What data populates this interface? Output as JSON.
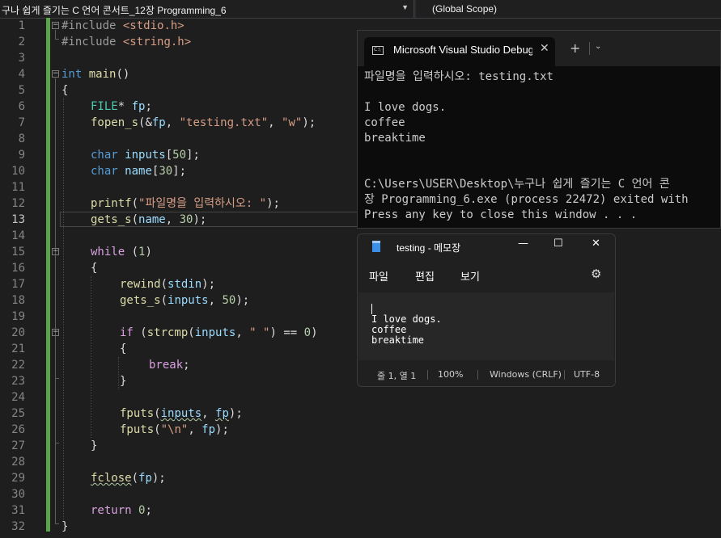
{
  "navbar": {
    "project": "구나 쉽게 즐기는 C 언어 콘서트_12장 Programming_6",
    "scope": "(Global Scope)"
  },
  "editor": {
    "line_numbers": [
      "1",
      "2",
      "3",
      "4",
      "5",
      "6",
      "7",
      "8",
      "9",
      "10",
      "11",
      "12",
      "13",
      "14",
      "15",
      "16",
      "17",
      "18",
      "19",
      "20",
      "21",
      "22",
      "23",
      "24",
      "25",
      "26",
      "27",
      "28",
      "29",
      "30",
      "31",
      "32"
    ],
    "active_line": "13",
    "code": {
      "l1_pp": "#include",
      "l1_hdr": "<stdio.h>",
      "l2_pp": "#include",
      "l2_hdr": "<string.h>",
      "l4_kw": "int",
      "l4_fn": "main",
      "l4_rest": "()",
      "l5": "{",
      "l6_ty": "FILE",
      "l6_star": "* ",
      "l6_var": "fp",
      "l6_semi": ";",
      "l7_fn": "fopen_s",
      "l7_a": "(&",
      "l7_var": "fp",
      "l7_b": ", ",
      "l7_s1": "\"testing.txt\"",
      "l7_c": ", ",
      "l7_s2": "\"w\"",
      "l7_d": ");",
      "l9_kw": "char",
      "l9_var": "inputs",
      "l9_a": "[",
      "l9_num": "50",
      "l9_b": "];",
      "l10_kw": "char",
      "l10_var": "name",
      "l10_a": "[",
      "l10_num": "30",
      "l10_b": "];",
      "l12_fn": "printf",
      "l12_a": "(",
      "l12_str": "\"파일명을 입력하시오: \"",
      "l12_b": ");",
      "l13_fn": "gets_s",
      "l13_a": "(",
      "l13_var": "name",
      "l13_b": ", ",
      "l13_num": "30",
      "l13_c": ");",
      "l15_kw": "while",
      "l15_a": " (",
      "l15_num": "1",
      "l15_b": ")",
      "l16": "{",
      "l17_fn": "rewind",
      "l17_a": "(",
      "l17_var": "stdin",
      "l17_b": ");",
      "l18_fn": "gets_s",
      "l18_a": "(",
      "l18_var": "inputs",
      "l18_b": ", ",
      "l18_num": "50",
      "l18_c": ");",
      "l20_kw": "if",
      "l20_a": " (",
      "l20_fn": "strcmp",
      "l20_b": "(",
      "l20_var": "inputs",
      "l20_c": ", ",
      "l20_str": "\" \"",
      "l20_d": ") == ",
      "l20_num": "0",
      "l20_e": ")",
      "l21": "{",
      "l22_kw": "break",
      "l22_a": ";",
      "l23": "}",
      "l25_fn": "fputs",
      "l25_a": "(",
      "l25_var": "inputs",
      "l25_b": ", ",
      "l25_var2": "fp",
      "l25_c": ");",
      "l26_fn": "fputs",
      "l26_a": "(",
      "l26_str": "\"\\n\"",
      "l26_b": ", ",
      "l26_var": "fp",
      "l26_c": ");",
      "l27": "}",
      "l29_fn": "fclose",
      "l29_a": "(",
      "l29_var": "fp",
      "l29_b": ");",
      "l31_kw": "return",
      "l31_num": "0",
      "l31_a": ";",
      "l32": "}"
    },
    "fold_glyph": "−"
  },
  "console": {
    "tab_icon_label": "C:\\",
    "tab_title": "Microsoft Visual Studio Debug",
    "close_glyph": "✕",
    "plus_glyph": "+",
    "dropdown_glyph": "⌄",
    "lines": [
      "파일명을 입력하시오: testing.txt",
      "",
      "I love dogs.",
      "coffee",
      "breaktime",
      "",
      "",
      "C:\\Users\\USER\\Desktop\\누구나 쉽게 즐기는 C 언어 콘",
      "장 Programming_6.exe (process 22472) exited with",
      "Press any key to close this window . . ."
    ]
  },
  "notepad": {
    "title": "testing - 메모장",
    "controls": {
      "minimize": "—",
      "maximize": "☐",
      "close": "✕"
    },
    "menu": [
      "파일",
      "편집",
      "보기"
    ],
    "settings_glyph": "⚙",
    "content_lines": [
      "",
      "I love dogs.",
      "coffee",
      "breaktime"
    ],
    "status": {
      "position": "줄 1, 열 1",
      "zoom": "100%",
      "line_ending": "Windows (CRLF)",
      "encoding": "UTF-8"
    }
  },
  "colors": {
    "editor_bg": "#1e1e1e",
    "keyword": "#569cd6",
    "control_keyword": "#d8a0df",
    "string": "#d69d85",
    "function": "#dcdcaa",
    "type": "#4ec9b0",
    "variable": "#9cdcfe",
    "number": "#b5cea8",
    "change_bar": "#57a64a"
  }
}
